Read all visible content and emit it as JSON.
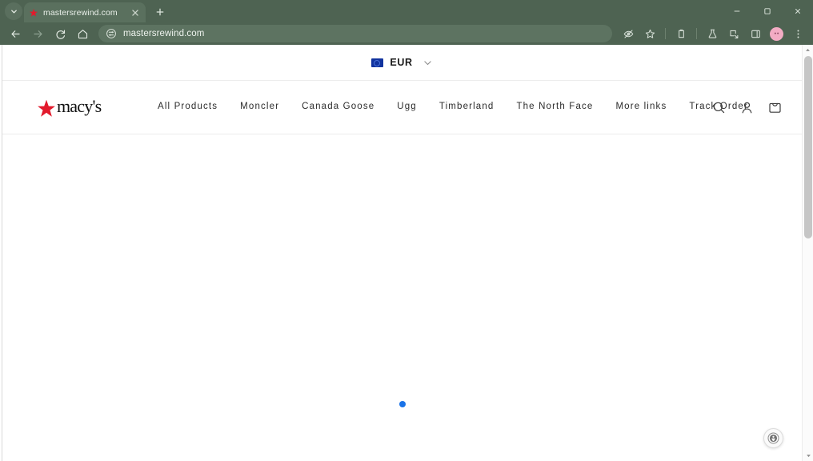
{
  "browser": {
    "tab_search_icon": "chevron-down-icon",
    "tab": {
      "title": "mastersrewind.com",
      "favicon": "macys-star-favicon",
      "close_icon": "close-icon"
    },
    "new_tab_label": "+",
    "window_controls": {
      "minimize": "minimize-icon",
      "maximize": "maximize-icon",
      "close": "close-icon"
    },
    "nav": {
      "back_icon": "arrow-back-icon",
      "forward_icon": "arrow-forward-icon",
      "reload_icon": "reload-icon",
      "home_icon": "home-icon"
    },
    "omnibox": {
      "url": "mastersrewind.com",
      "site_settings_icon": "tune-icon"
    },
    "toolbar_right": {
      "tracking_protection_icon": "eye-off-icon",
      "bookmark_icon": "star-icon",
      "extensions_icon": "extensions-icon",
      "labs_icon": "flask-icon",
      "share_icon": "share-icon",
      "side_panel_icon": "side-panel-icon",
      "profile_icon": "avatar-icon",
      "menu_icon": "three-dots-icon"
    }
  },
  "page": {
    "currency_bar": {
      "flag_icon": "eu-flag-icon",
      "code": "EUR",
      "chevron_icon": "chevron-down-icon"
    },
    "header": {
      "logo_text": "macy's",
      "logo_icon": "macys-star-icon",
      "nav_links": [
        {
          "label": "All Products"
        },
        {
          "label": "Moncler"
        },
        {
          "label": "Canada Goose"
        },
        {
          "label": "Ugg"
        },
        {
          "label": "Timberland"
        },
        {
          "label": "The North Face"
        },
        {
          "label": "More links"
        },
        {
          "label": "Track Order"
        }
      ],
      "icons": {
        "search": "search-icon",
        "account": "user-icon",
        "cart": "shopping-bag-icon"
      }
    },
    "body": {
      "carousel_indicator": "active-carousel-dot"
    },
    "widget": {
      "icon": "accessibility-widget-icon"
    }
  },
  "colors": {
    "chrome": "#4e6352",
    "tab_active": "#5a705e",
    "omnibox": "#5d7361",
    "macys_red": "#e21a2c",
    "flag_blue": "#11339e",
    "dot_blue": "#1a73e8",
    "avatar_pink": "#f3acc4",
    "nav_text": "#2b2b2b"
  }
}
